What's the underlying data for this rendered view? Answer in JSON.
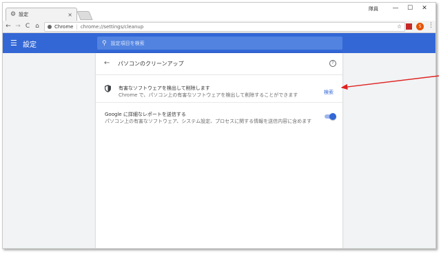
{
  "window": {
    "tab_title": "設定",
    "tab_close": "×",
    "user_label": "隊員",
    "min": "—",
    "max": "☐",
    "close": "✕"
  },
  "toolbar": {
    "back": "←",
    "forward": "→",
    "reload": "C",
    "home": "⌂",
    "omni_chrome": "Chrome",
    "omni_sep": "|",
    "url": "chrome://settings/cleanup",
    "star": "☆",
    "ext2_label": "S",
    "menu": "⋮"
  },
  "header": {
    "menu_icon": "☰",
    "title": "設定",
    "search_icon": "⚲",
    "search_placeholder": "設定項目を検索"
  },
  "cleanup": {
    "back": "←",
    "title": "パソコンのクリーンアップ",
    "help": "?",
    "find_title": "有害なソフトウェアを検出して削除します",
    "find_desc": "Chrome で、パソコン上の有害なソフトウェアを検出して削除することができます",
    "find_button": "検索",
    "report_title": "Google に詳細なレポートを送信する",
    "report_desc": "パソコン上の有害なソフトウェア、システム設定、プロセスに関する情報を送信内容に含めます",
    "report_enabled": true
  },
  "colors": {
    "accent": "#3367d6",
    "annotation": "#e02020"
  },
  "icons": [
    "gear-icon",
    "close-icon",
    "back-icon",
    "forward-icon",
    "reload-icon",
    "home-icon",
    "star-icon",
    "menu-icon",
    "search-icon",
    "shield-icon",
    "help-icon"
  ]
}
